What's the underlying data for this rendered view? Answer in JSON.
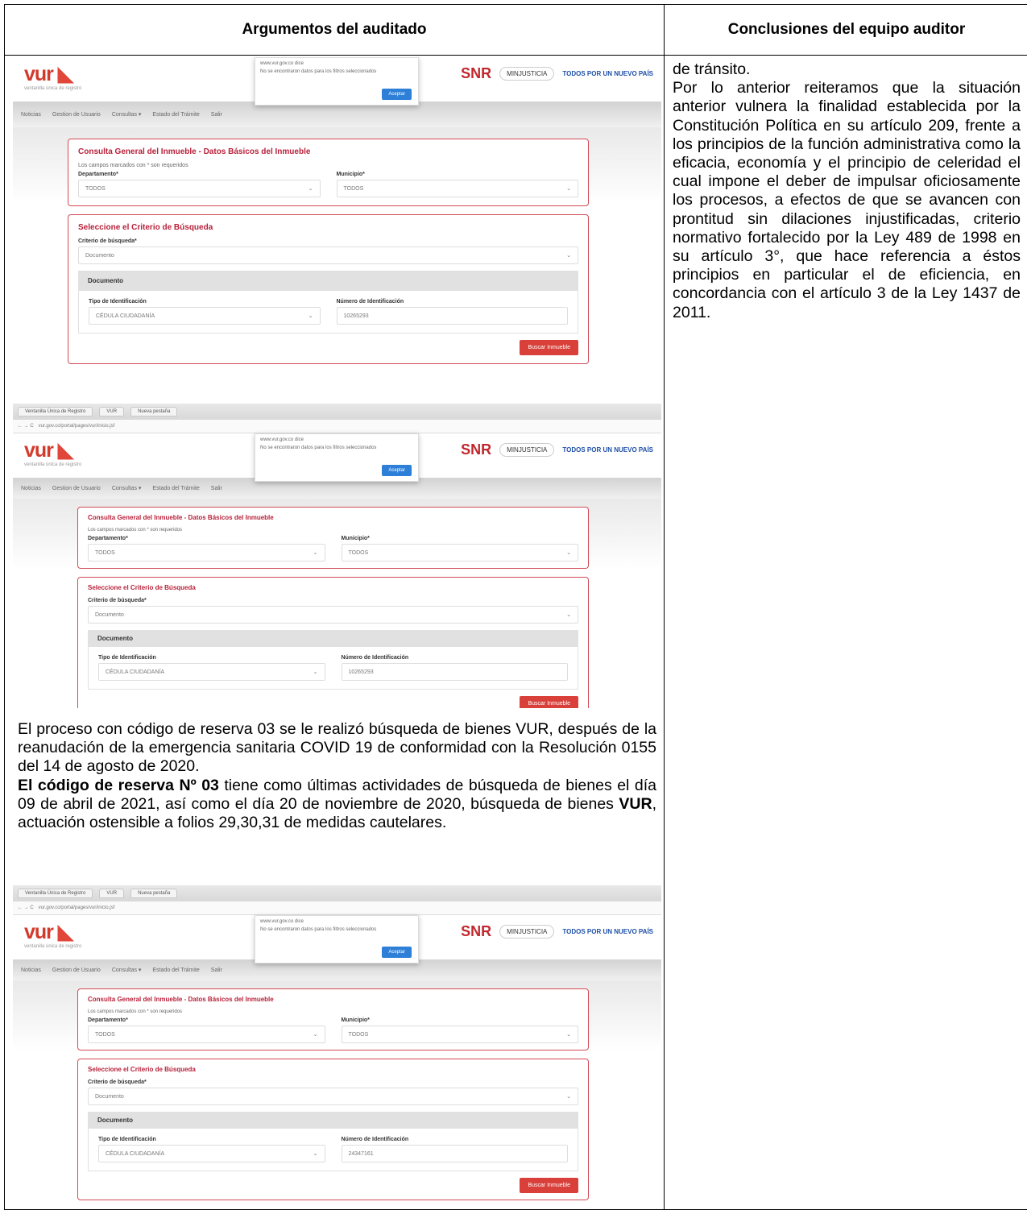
{
  "headers": {
    "left": "Argumentos del auditado",
    "right": "Conclusiones del equipo auditor"
  },
  "conclusion": {
    "first_line": "de tránsito.",
    "text": "Por lo anterior reiteramos que la situación anterior vulnera la finalidad establecida por la Constitución Política en su artículo 209, frente a los principios de la función administrativa como la eficacia, economía y el principio de celeridad el cual impone el deber de impulsar oficiosamente los procesos, a efectos de que se avancen con prontitud sin dilaciones injustificadas, criterio normativo fortalecido por la Ley 489 de 1998 en su artículo 3°, que hace referencia a éstos principios en particular el de eficiencia, en concordancia con el artículo 3 de la Ley 1437 de 2011."
  },
  "paragraph1": "El proceso con código de reserva 03 se le realizó búsqueda de bienes VUR, después de la reanudación de la emergencia sanitaria COVID 19 de conformidad con la Resolución 0155 del 14 de agosto de 2020.",
  "paragraph2": {
    "bold_lead": "El código de reserva Nº 03",
    "mid": " tiene como últimas actividades de búsqueda de bienes el día 09 de abril de 2021, así como el día 20 de noviembre de 2020, búsqueda de bienes ",
    "bold_vur": "VUR",
    "tail": ", actuación ostensible a folios 29,30,31 de medidas cautelares."
  },
  "screenshot": {
    "logo": "vur",
    "logo_sub": "ventanilla única de registro",
    "dialog_title": "www.vur.gov.co dice",
    "dialog_msg": "No se encontraron datos para los filtros seleccionados",
    "dialog_btn": "Aceptar",
    "snr": "SNR",
    "minjusticia": "MINJUSTICIA",
    "todos": "TODOS POR UN NUEVO PAÍS",
    "nav": [
      "Noticias",
      "Gestion de Usuario",
      "Consultas ▾",
      "Estado del Trámite",
      "Salir"
    ],
    "panel1_title": "Consulta General del Inmueble - Datos Básicos del Inmueble",
    "required_note": "Los campos marcados con * son requeridos",
    "departamento_label": "Departamento*",
    "departamento_value": "TODOS",
    "municipio_label": "Municipio*",
    "municipio_value": "TODOS",
    "panel2_title": "Seleccione el Criterio de Búsqueda",
    "criterio_label": "Criterio de búsqueda*",
    "criterio_value": "Documento",
    "documento_bar": "Documento",
    "tipo_label": "Tipo de Identificación",
    "tipo_value": "CÉDULA CIUDADANÍA",
    "numero_label": "Número de Identificación",
    "numero_value_1": "10265293",
    "numero_value_2": "10265293",
    "numero_value_3": "24347161",
    "buscar_btn": "Buscar Inmueble",
    "browser_tab1": "Ventanilla Única de Registro",
    "browser_tab2": "VUR",
    "browser_tab3": "Nueva pestaña",
    "browser_url": "vur.gov.co/portal/pages/vur/inicio.jsf"
  }
}
